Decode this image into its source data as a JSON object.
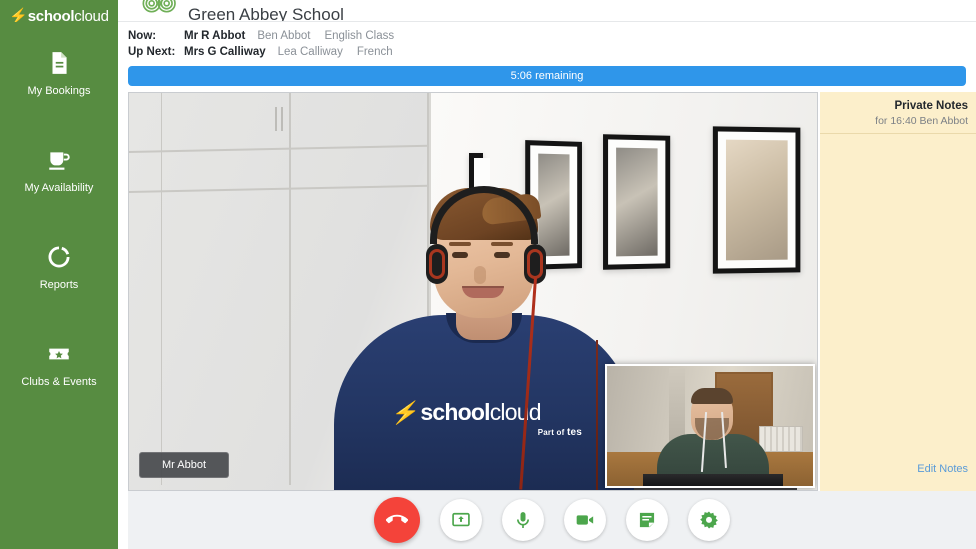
{
  "brand": {
    "name_bold": "school",
    "name_light": "cloud",
    "bolt_glyph": "⚡"
  },
  "sidebar": {
    "items": [
      {
        "label": "My Bookings",
        "icon": "document-icon"
      },
      {
        "label": "My Availability",
        "icon": "coffee-cup-icon"
      },
      {
        "label": "Reports",
        "icon": "pie-chart-icon"
      },
      {
        "label": "Clubs & Events",
        "icon": "ticket-star-icon"
      }
    ]
  },
  "header": {
    "school_name": "Green Abbey School",
    "logo_icon": "green-spiral-logo"
  },
  "meeting": {
    "now_label": "Now:",
    "now_teacher_title": "Mr",
    "now_teacher_name": "R Abbot",
    "now_student": "Ben Abbot",
    "now_subject": "English Class",
    "next_label": "Up Next:",
    "next_teacher_title": "Mrs",
    "next_teacher_name": "G Calliway",
    "next_student": "Lea Calliway",
    "next_subject": "French"
  },
  "timer": {
    "text": "5:06 remaining",
    "color": "#2F96EA"
  },
  "video": {
    "participant_name": "Mr Abbot",
    "shirt_logo_bold": "school",
    "shirt_logo_light": "cloud",
    "shirt_sub_prefix": "Part of",
    "shirt_sub_brand": "tes",
    "self_view_name": "self-view"
  },
  "notes": {
    "title": "Private Notes",
    "subtitle": "for 16:40 Ben Abbot",
    "edit_link": "Edit Notes",
    "background": "#FCEFCB",
    "link_color": "#5A9BD8",
    "value": ""
  },
  "controls": {
    "buttons": [
      {
        "name": "end-call-button",
        "icon": "phone-hangup-icon",
        "label": "End call",
        "color": "#F4433A"
      },
      {
        "name": "share-screen-button",
        "icon": "screen-share-icon",
        "label": "Share screen",
        "color": "#4CA64C"
      },
      {
        "name": "microphone-button",
        "icon": "microphone-icon",
        "label": "Microphone",
        "color": "#4CA64C"
      },
      {
        "name": "camera-button",
        "icon": "video-camera-icon",
        "label": "Camera",
        "color": "#4CA64C"
      },
      {
        "name": "notes-button",
        "icon": "notes-icon",
        "label": "Notes",
        "color": "#4CA64C"
      },
      {
        "name": "settings-button",
        "icon": "gear-icon",
        "label": "Settings",
        "color": "#4CA64C"
      }
    ]
  },
  "colors": {
    "sidebar_green": "#578C41",
    "accent_blue": "#2F96EA",
    "notes_cream": "#FCEFCB",
    "control_bar": "#EFF1F3"
  }
}
